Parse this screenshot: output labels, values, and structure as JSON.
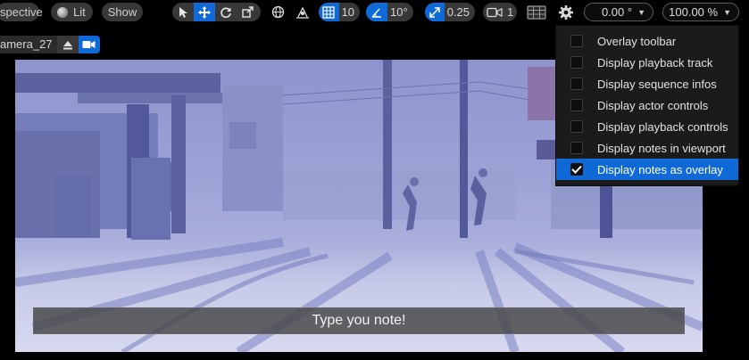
{
  "toolbar": {
    "perspective_label": "spective",
    "lit_label": "Lit",
    "show_label": "Show",
    "grid_snap_value": "10",
    "angle_snap_value": "10°",
    "scale_snap_value": "0.25",
    "camera_speed_value": "1",
    "rotation_field_value": "0.00 °",
    "zoom_field_value": "100.00 %"
  },
  "camera_tab": {
    "name": "amera_27"
  },
  "viewport": {
    "note_text": "Type you note!"
  },
  "menu": {
    "items": [
      {
        "label": "Overlay toolbar",
        "checked": false
      },
      {
        "label": "Display playback track",
        "checked": false
      },
      {
        "label": "Display sequence infos",
        "checked": false
      },
      {
        "label": "Display actor controls",
        "checked": false
      },
      {
        "label": "Display playback controls",
        "checked": false
      },
      {
        "label": "Display notes in viewport",
        "checked": false
      },
      {
        "label": "Display notes as overlay",
        "checked": true
      }
    ]
  },
  "colors": {
    "accent": "#0f6ad8",
    "menu_bg": "#1b1b1b",
    "toolbar_bg": "#000000"
  }
}
